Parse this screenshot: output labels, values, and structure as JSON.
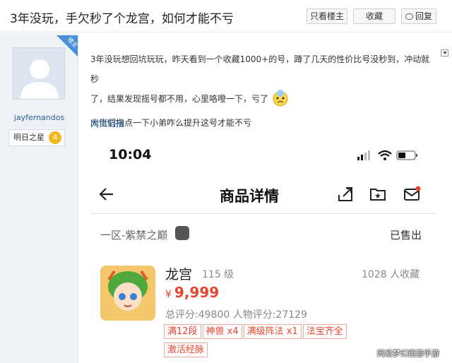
{
  "header": {
    "title": "3年没玩，手欠秒了个龙宫，如何才能不亏",
    "only_op_label": "只看楼主",
    "favorite_label": "收藏",
    "reply_label": "回复"
  },
  "user": {
    "badge_label": "楼主",
    "username": "jayfernandos",
    "rank_label": "明日之星",
    "rank_level": "4"
  },
  "post": {
    "line1": "3年没玩想回坑玩玩，昨天看到一个收藏1000+的号，蹲了几天的性价比号没秒到，冲动就秒",
    "line2": "了，结果发现摇号都不用，心里咯噔一下，亏了",
    "line3": "大佬们指点一下小弟咋么提升这号才能不亏",
    "link_label": "网页链接"
  },
  "screenshot": {
    "time": "10:04",
    "page_title": "商品详情",
    "server": "一区-紫禁之巅",
    "sold_status": "已售出",
    "char_name": "龙宫",
    "char_level": "115 级",
    "collect_count": "1028 人收藏",
    "currency": "¥",
    "price": "9,999",
    "scores": "总评分:49800   人物评分:27129",
    "tags": [
      "满12段",
      "神兽 x4",
      "满级阵法 x1",
      "法宝齐全",
      "激活经脉"
    ]
  },
  "watermark": "网易梦幻西游手游",
  "colors": {
    "price_red": "#e8452f",
    "link_blue": "#2a5d9f"
  }
}
